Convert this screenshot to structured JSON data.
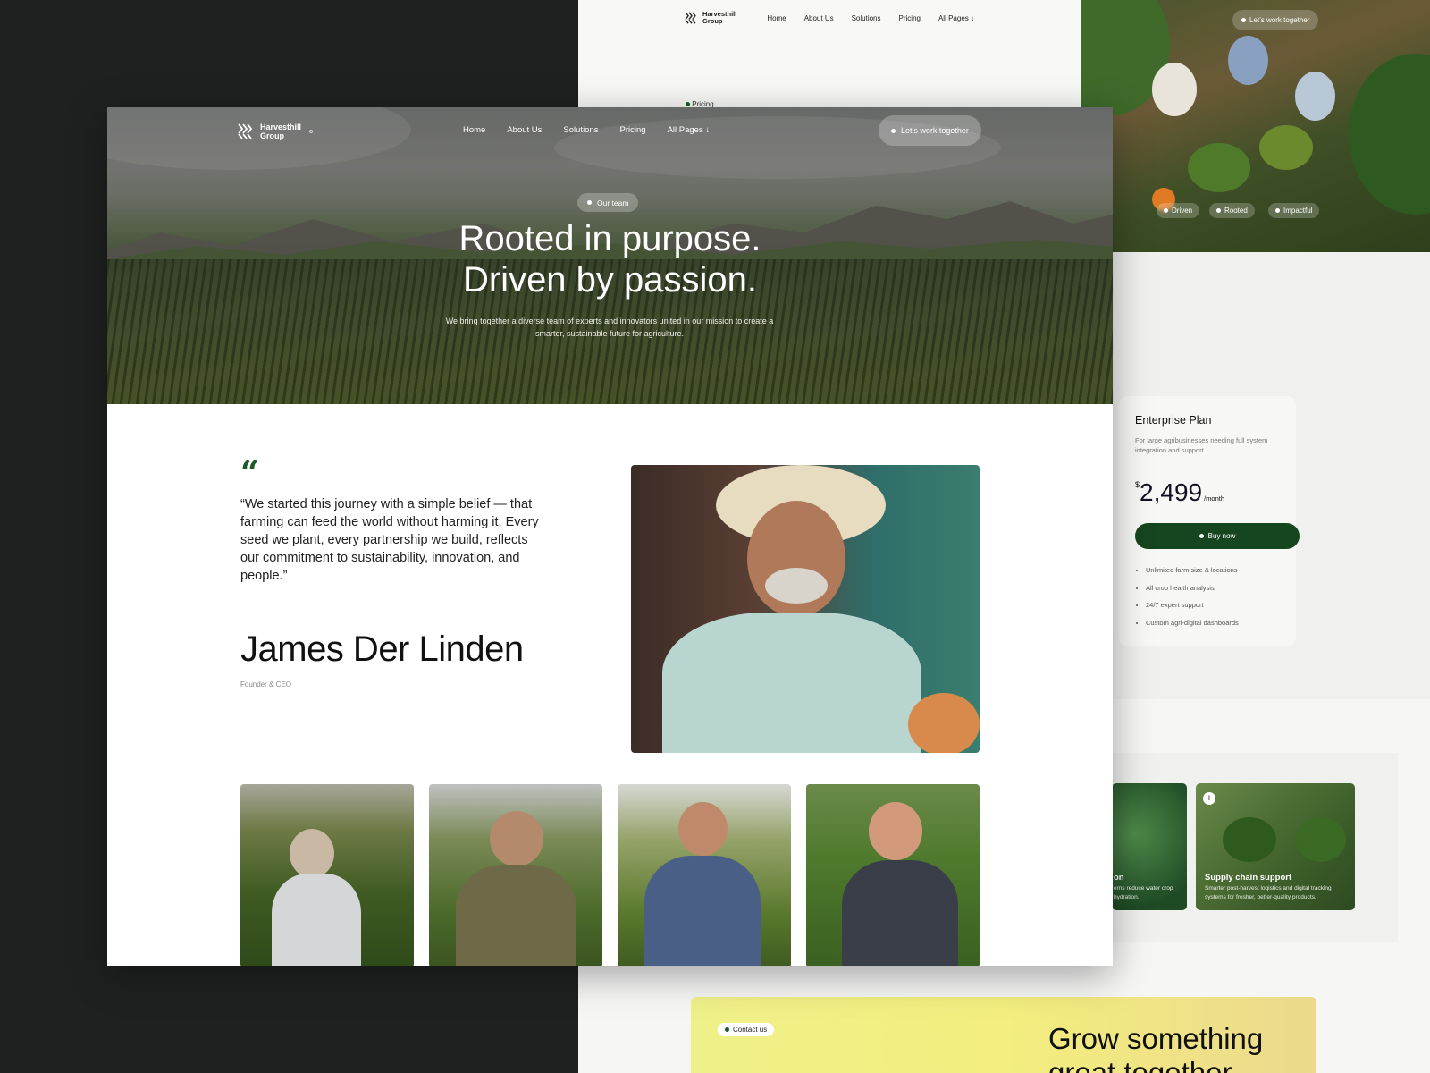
{
  "brand": {
    "name_line1": "Harvesthill",
    "name_line2": "Group"
  },
  "nav": {
    "home": "Home",
    "about": "About Us",
    "solutions": "Solutions",
    "pricing": "Pricing",
    "all_pages": "All Pages"
  },
  "cta_button": "Let’s work together",
  "back_top": {
    "pill": "Pricing"
  },
  "photo_tags": [
    "Driven",
    "Rooted",
    "Impactful"
  ],
  "hero": {
    "pill": "Our team",
    "title_line1": "Rooted in purpose.",
    "title_line2": "Driven by passion.",
    "subtitle": "We bring together a diverse team of experts and innovators united in our mission to create a smarter, sustainable future for agriculture."
  },
  "testimonial": {
    "quote_mark": "“",
    "quote": "“We started this journey with a simple belief — that farming can feed the world without harming it. Every seed we plant, every partnership we build, reflects our commitment to sustainability, innovation, and people.”",
    "name": "James Der Linden",
    "role": "Founder & CEO"
  },
  "pricing": {
    "title": "Enterprise Plan",
    "description": "For large agribusinesses needing full system integration and support.",
    "currency": "$",
    "amount": "2,499",
    "period": "/month",
    "buy_label": "Buy now",
    "features": [
      "Unlimited farm size & locations",
      "All crop health analysis",
      "24/7 expert support",
      "Custom agri-digital dashboards"
    ]
  },
  "solutions": [
    {
      "title": "on",
      "desc": "erns reduce water crop hydration."
    },
    {
      "title": "Supply chain support",
      "desc": "Smarter post-harvest logistics and digital tracking systems for fresher, better-quality products."
    }
  ],
  "contact": {
    "pill": "Contact us",
    "title_line1": "Grow something",
    "title_line2": "great together"
  },
  "colors": {
    "brand_green": "#15461f",
    "cta_yellow": "#f0f08a",
    "dark_bg": "#1f2121"
  }
}
